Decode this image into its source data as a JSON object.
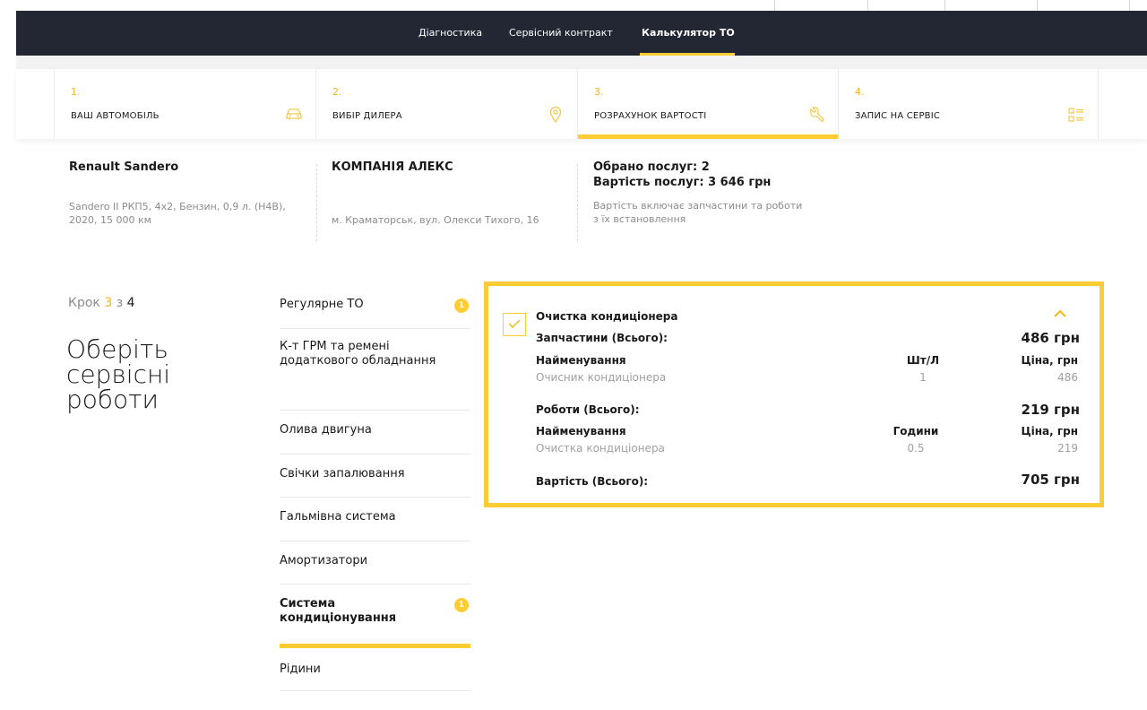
{
  "nav": {
    "items": [
      {
        "label": "Діагностика",
        "active": false
      },
      {
        "label": "Сервісний контракт",
        "active": false
      },
      {
        "label": "Калькулятор ТО",
        "active": true
      }
    ]
  },
  "steps": [
    {
      "num": "1.",
      "label": "ВАШ АВТОМОБІЛЬ",
      "icon": "car-icon"
    },
    {
      "num": "2.",
      "label": "ВИБІР ДИЛЕРА",
      "icon": "map-pin-icon"
    },
    {
      "num": "3.",
      "label": "РОЗРАХУНОК ВАРТОСТІ",
      "icon": "wrench-icon",
      "active": true
    },
    {
      "num": "4.",
      "label": "ЗАПИС НА СЕРВІС",
      "icon": "checklist-icon"
    }
  ],
  "summary": {
    "car": {
      "title": "Renault Sandero",
      "details": "Sandero II РКП5, 4x2, Бензин, 0,9 л. (H4B), 2020, 15 000 км"
    },
    "dealer": {
      "title": "КОМПАНІЯ АЛЕКС",
      "address": "м. Краматорськ, вул. Олекси Тихого, 16"
    },
    "cost": {
      "services": "Обрано послуг: 2",
      "total": "Вартість послуг: 3 646 грн",
      "note": "Вартість включає запчастини та роботи з їх встановлення"
    }
  },
  "stepper": {
    "prefix": "Крок",
    "current": "3",
    "of": "з",
    "total": "4"
  },
  "heading": "Оберіть сервісні роботи",
  "categories": [
    {
      "label": "Регулярне ТО",
      "badge": "1"
    },
    {
      "label": "К-т ГРМ та ремені додаткового обладнання"
    },
    {
      "label": "Олива двигуна"
    },
    {
      "label": "Свічки запалювання"
    },
    {
      "label": "Гальмівна система"
    },
    {
      "label": "Амортизатори"
    },
    {
      "label": "Система кондиціонування",
      "badge": "1",
      "active": true
    },
    {
      "label": "Рідини"
    }
  ],
  "service": {
    "title": "Очистка кондиціонера",
    "parts": {
      "label": "Запчастини (Всього):",
      "total": "486 грн",
      "col_name": "Найменування",
      "col_qty": "Шт/Л",
      "col_price": "Ціна, грн",
      "rows": [
        {
          "name": "Очисник кондиціонера",
          "qty": "1",
          "price": "486"
        }
      ]
    },
    "labor": {
      "label": "Роботи (Всього):",
      "total": "219 грн",
      "col_name": "Найменування",
      "col_qty": "Години",
      "col_price": "Ціна, грн",
      "rows": [
        {
          "name": "Очистка кондиціонера",
          "qty": "0.5",
          "price": "219"
        }
      ]
    },
    "grand_label": "Вартість (Всього):",
    "grand_total": "705 грн"
  },
  "colors": {
    "accent": "#ffcc33",
    "nav_bg": "#222733",
    "step_num": "#f6b31b"
  }
}
